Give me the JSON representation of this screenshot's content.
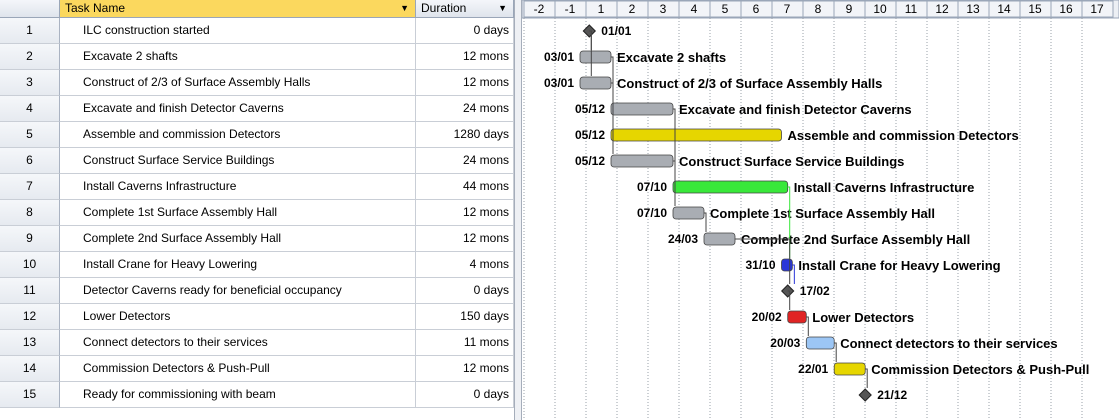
{
  "columns": {
    "id": "",
    "task_name": "Task Name",
    "duration": "Duration"
  },
  "timescale": [
    "-2",
    "-1",
    "1",
    "2",
    "3",
    "4",
    "5",
    "6",
    "7",
    "8",
    "9",
    "10",
    "11",
    "12",
    "13",
    "14",
    "15",
    "16",
    "17"
  ],
  "tasks": [
    {
      "id": "1",
      "name": "ILC construction started",
      "duration": "0 days",
      "start_label": "01/01",
      "bar_label": "",
      "type": "milestone",
      "start": 0.3,
      "end": 0.3
    },
    {
      "id": "2",
      "name": "Excavate 2 shafts",
      "duration": "12 mons",
      "start_label": "03/01",
      "bar_label": "Excavate 2 shafts",
      "type": "task",
      "color": "gray",
      "start": 0.0,
      "end": 1.0
    },
    {
      "id": "3",
      "name": "Construct of 2/3 of Surface Assembly Halls",
      "duration": "12 mons",
      "start_label": "03/01",
      "bar_label": "Construct of 2/3 of Surface Assembly Halls",
      "type": "task",
      "color": "gray",
      "start": 0.0,
      "end": 1.0
    },
    {
      "id": "4",
      "name": "Excavate and finish Detector Caverns",
      "duration": "24 mons",
      "start_label": "05/12",
      "bar_label": "Excavate and finish Detector Caverns",
      "type": "task",
      "color": "gray",
      "start": 1.0,
      "end": 3.0
    },
    {
      "id": "5",
      "name": "Assemble and commission Detectors",
      "duration": "1280 days",
      "start_label": "05/12",
      "bar_label": "Assemble and commission Detectors",
      "type": "task",
      "color": "yellow",
      "start": 1.0,
      "end": 6.5
    },
    {
      "id": "6",
      "name": "Construct Surface Service Buildings",
      "duration": "24 mons",
      "start_label": "05/12",
      "bar_label": "Construct Surface Service Buildings",
      "type": "task",
      "color": "gray",
      "start": 1.0,
      "end": 3.0
    },
    {
      "id": "7",
      "name": "Install Caverns Infrastructure",
      "duration": "44 mons",
      "start_label": "07/10",
      "bar_label": "Install Caverns Infrastructure",
      "type": "task",
      "color": "green",
      "start": 3.0,
      "end": 6.7
    },
    {
      "id": "8",
      "name": "Complete 1st Surface Assembly Hall",
      "duration": "12 mons",
      "start_label": "07/10",
      "bar_label": "Complete 1st Surface Assembly Hall",
      "type": "task",
      "color": "gray",
      "start": 3.0,
      "end": 4.0
    },
    {
      "id": "9",
      "name": "Complete 2nd Surface Assembly Hall",
      "duration": "12 mons",
      "start_label": "24/03",
      "bar_label": "Complete 2nd Surface Assembly Hall",
      "type": "task",
      "color": "gray",
      "start": 4.0,
      "end": 5.0
    },
    {
      "id": "10",
      "name": "Install Crane for Heavy Lowering",
      "duration": "4 mons",
      "start_label": "31/10",
      "bar_label": "Install Crane for Heavy Lowering",
      "type": "task",
      "color": "blue",
      "start": 6.5,
      "end": 6.85
    },
    {
      "id": "11",
      "name": "Detector Caverns ready for beneficial occupancy",
      "duration": "0 days",
      "start_label": "",
      "bar_label": "17/02",
      "type": "milestone",
      "start": 6.7,
      "end": 6.7
    },
    {
      "id": "12",
      "name": "Lower Detectors",
      "duration": "150 days",
      "start_label": "20/02",
      "bar_label": "Lower Detectors",
      "type": "task",
      "color": "red",
      "start": 6.7,
      "end": 7.3
    },
    {
      "id": "13",
      "name": "Connect detectors to their services",
      "duration": "11 mons",
      "start_label": "20/03",
      "bar_label": "Connect detectors to their services",
      "type": "task",
      "color": "lightblue",
      "start": 7.3,
      "end": 8.2
    },
    {
      "id": "14",
      "name": "Commission Detectors & Push-Pull",
      "duration": "12 mons",
      "start_label": "22/01",
      "bar_label": "Commission Detectors & Push-Pull",
      "type": "task",
      "color": "yellow",
      "start": 8.2,
      "end": 9.2
    },
    {
      "id": "15",
      "name": "Ready for commissioning with beam",
      "duration": "0 days",
      "start_label": "",
      "bar_label": "21/12",
      "type": "milestone",
      "start": 9.2,
      "end": 9.2
    }
  ],
  "colors": {
    "gray": "#a9adb3",
    "yellow": "#e6d600",
    "green": "#39e83a",
    "blue": "#2a36d8",
    "red": "#e02424",
    "lightblue": "#9cc6f5",
    "header_selected": "#fbd85e"
  }
}
